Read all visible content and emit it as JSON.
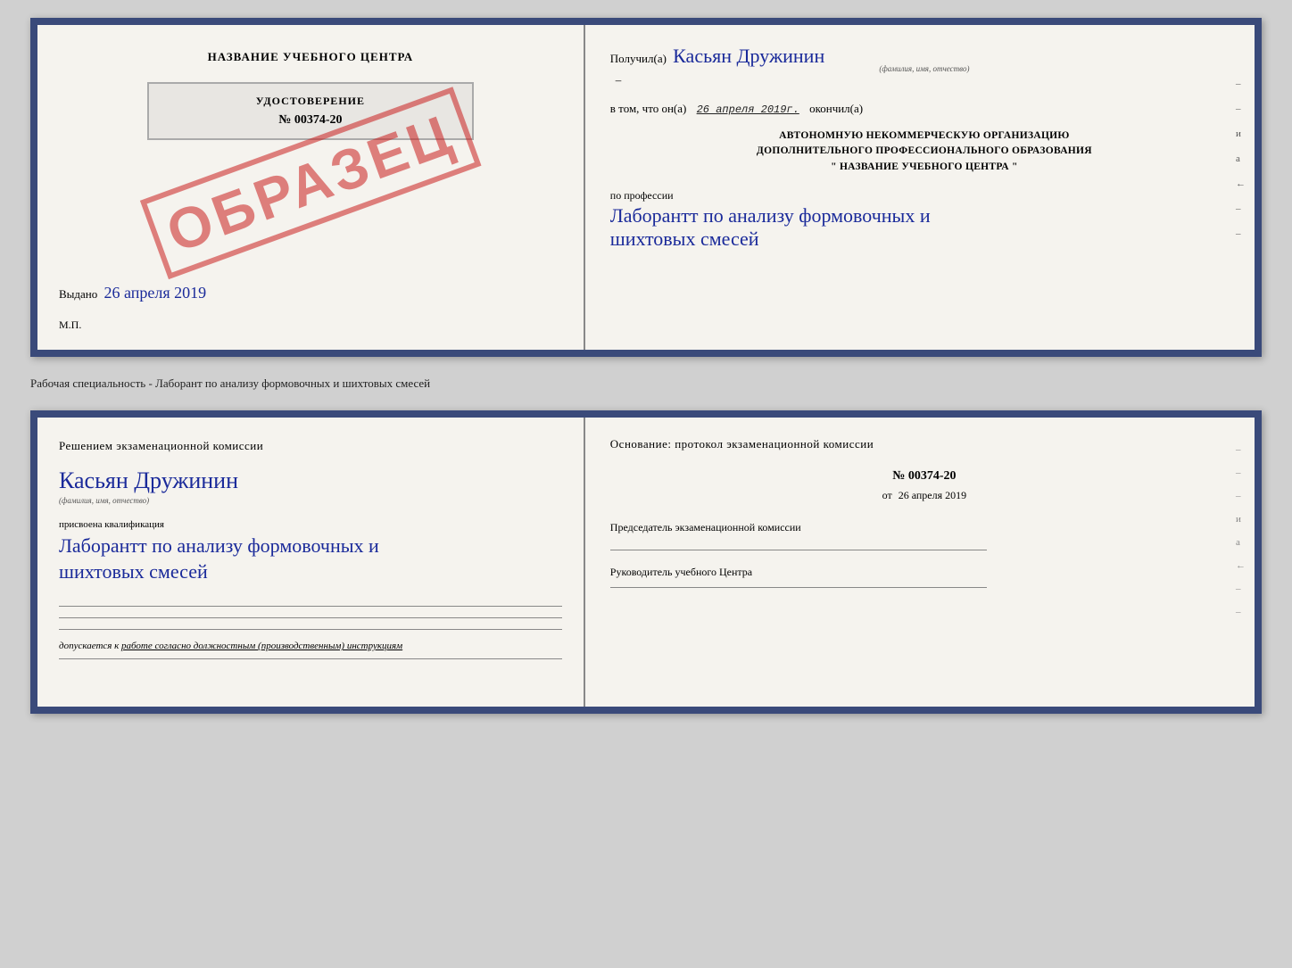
{
  "page": {
    "background": "#d0d0d0"
  },
  "top_card": {
    "left": {
      "training_center": "НАЗВАНИЕ УЧЕБНОГО ЦЕНТРА",
      "obrazec": "ОБРАЗЕЦ",
      "certificate_label": "УДОСТОВЕРЕНИЕ",
      "certificate_number": "№ 00374-20",
      "issued_label": "Выдано",
      "issued_date": "26 апреля 2019",
      "mp_label": "М.П."
    },
    "right": {
      "received_prefix": "Получил(а)",
      "received_name": "Касьян Дружинин",
      "received_subtitle": "(фамилия, имя, отчество)",
      "completed_prefix": "в том, что он(а)",
      "completed_date": "26 апреля 2019г.",
      "completed_suffix": "окончил(а)",
      "org_line1": "АВТОНОМНУЮ НЕКОММЕРЧЕСКУЮ ОРГАНИЗАЦИЮ",
      "org_line2": "ДОПОЛНИТЕЛЬНОГО ПРОФЕССИОНАЛЬНОГО ОБРАЗОВАНИЯ",
      "org_line3": "\"  НАЗВАНИЕ УЧЕБНОГО ЦЕНТРА  \"",
      "profession_prefix": "по профессии",
      "profession_name": "Лаборантт по анализу формовочных и шихтовых смесей"
    }
  },
  "specialty_label": "Рабочая специальность - Лаборант по анализу формовочных и шихтовых смесей",
  "bottom_card": {
    "left": {
      "decision_title": "Решением экзаменационной комиссии",
      "name": "Касьян Дружинин",
      "name_subtitle": "(фамилия, имя, отчество)",
      "qualification_prefix": "присвоена квалификация",
      "qualification_name": "Лаборантт по анализу формовочных и шихтовых смесей",
      "допускается_label": "допускается к",
      "допускается_text": "работе согласно должностным (производственным) инструкциям"
    },
    "right": {
      "basis_title": "Основание: протокол экзаменационной комиссии",
      "protocol_number": "№ 00374-20",
      "protocol_date_prefix": "от",
      "protocol_date": "26 апреля 2019",
      "chairman_label": "Председатель экзаменационной комиссии",
      "director_label": "Руководитель учебного Центра"
    }
  }
}
